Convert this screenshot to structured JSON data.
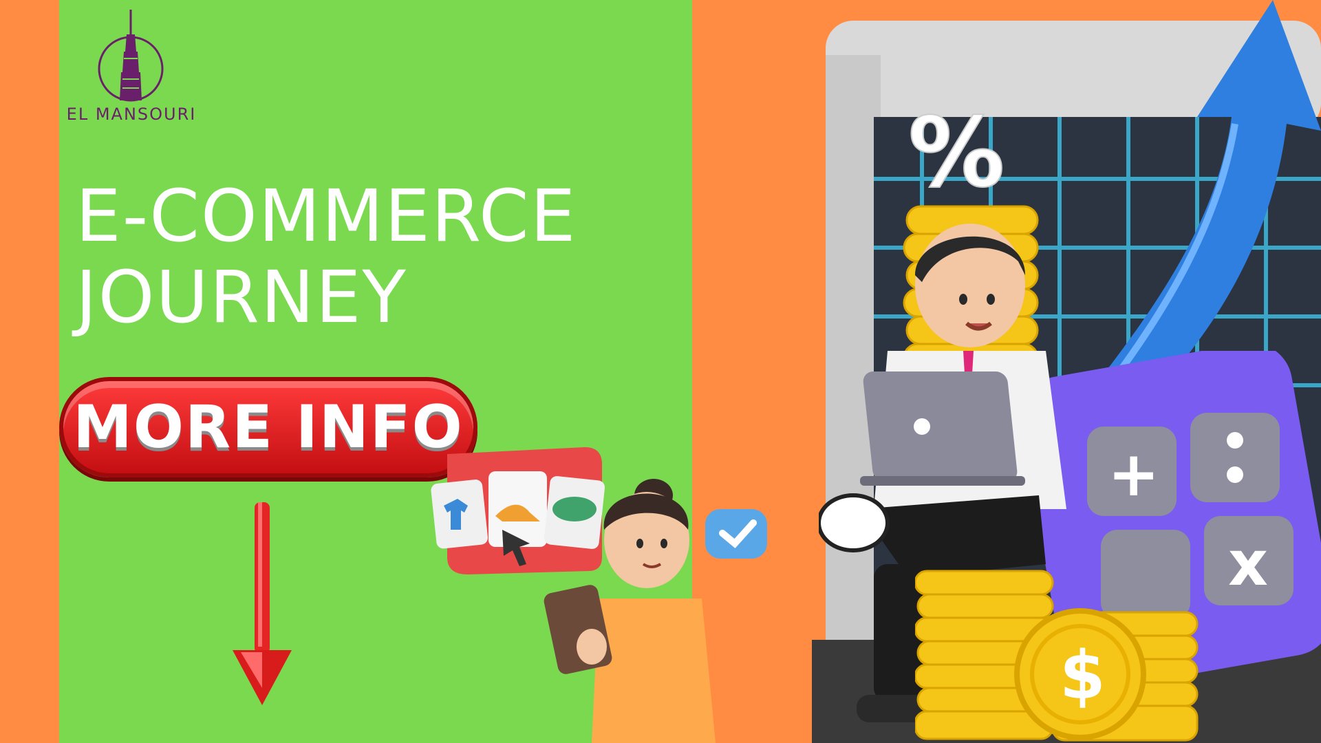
{
  "brand": {
    "name": "EL MANSOURI",
    "icon": "tower-logo-icon"
  },
  "hero": {
    "title_line1": "E-COMMERCE",
    "title_line2": "JOURNEY"
  },
  "cta": {
    "label": "MORE INFO"
  },
  "illustration": {
    "percent_symbol": "%",
    "dollar_symbol": "$",
    "calc_plus": "+",
    "calc_times": "x"
  },
  "colors": {
    "background": "#ff8c42",
    "panel": "#7ad94f",
    "button": "#d81b1b",
    "arrow": "#e52525",
    "logo": "#6a1f6a"
  }
}
